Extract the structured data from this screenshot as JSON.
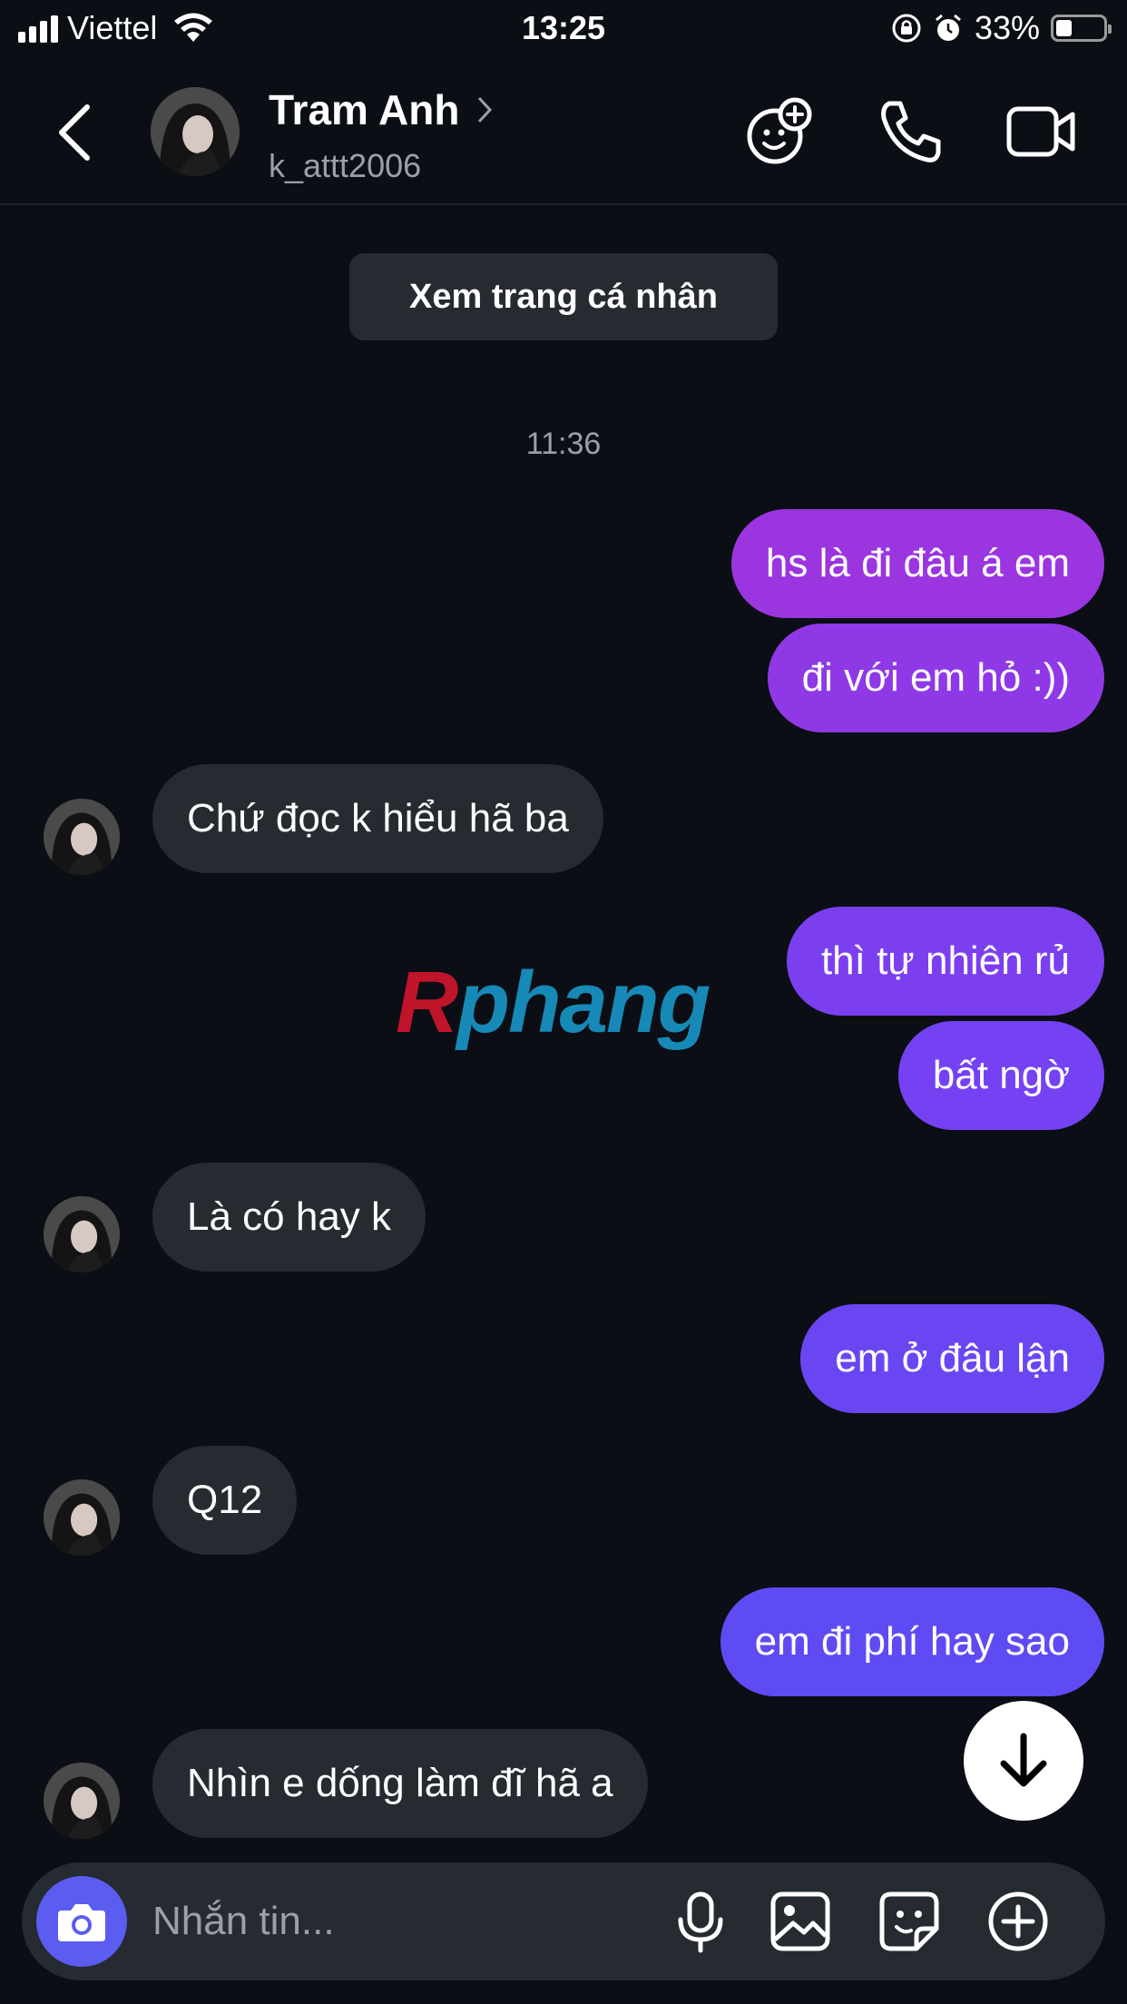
{
  "status_bar": {
    "carrier": "Viettel",
    "time": "13:25",
    "battery": "33%",
    "battery_level": 0.33
  },
  "header": {
    "name": "Tram Anh",
    "handle": "k_attt2006",
    "icons": [
      "back-icon",
      "effects-icon",
      "phone-icon",
      "video-icon"
    ]
  },
  "chat": {
    "profile_button": "Xem trang cá nhân",
    "timestamp": "11:36",
    "messages": [
      {
        "dir": "out",
        "text": "hs là đi đâu á em",
        "color": "#9b35e0"
      },
      {
        "dir": "out",
        "text": "đi với em hỏ :))",
        "color": "#8f39e6"
      },
      {
        "dir": "in",
        "text": "Chứ đọc k hiểu hã ba"
      },
      {
        "dir": "out",
        "text": "thì tự nhiên rủ",
        "color": "#7b3ff0"
      },
      {
        "dir": "out",
        "text": "bất ngờ",
        "color": "#7442f2"
      },
      {
        "dir": "in",
        "text": "Là có hay k"
      },
      {
        "dir": "out",
        "text": "em ở đâu lận",
        "color": "#6a46f3"
      },
      {
        "dir": "in",
        "text": "Q12"
      },
      {
        "dir": "out",
        "text": "em đi phí hay sao",
        "color": "#5f4bf3"
      },
      {
        "dir": "in",
        "text": "Nhìn e dống làm đĩ hã a"
      }
    ]
  },
  "watermark": {
    "first": "R",
    "rest": "phang"
  },
  "composer": {
    "placeholder": "Nhắn tin...",
    "accent": "#5b5cf0"
  }
}
